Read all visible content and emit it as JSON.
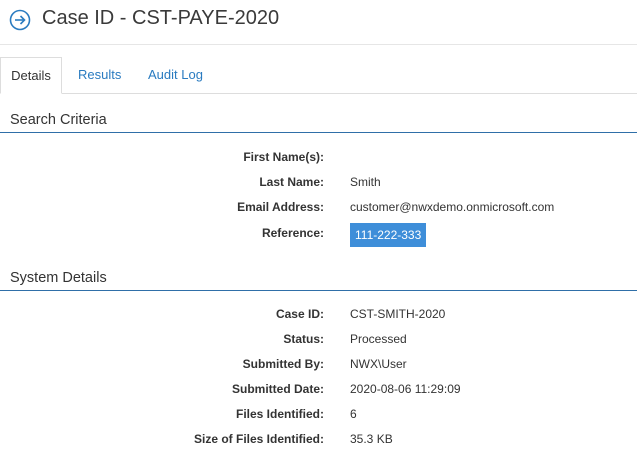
{
  "header": {
    "title": "Case ID - CST-PAYE-2020",
    "icon": "arrow-right-circle-icon",
    "accent_color": "#2a7bc0"
  },
  "tabs": [
    {
      "label": "Details",
      "active": true
    },
    {
      "label": "Results",
      "active": false
    },
    {
      "label": "Audit Log",
      "active": false
    }
  ],
  "search_criteria": {
    "title": "Search Criteria",
    "fields": [
      {
        "label": "First Name(s):",
        "value": ""
      },
      {
        "label": "Last Name:",
        "value": "Smith"
      },
      {
        "label": "Email Address:",
        "value": "customer@nwxdemo.onmicrosoft.com"
      },
      {
        "label": "Reference:",
        "value": "111-222-333"
      }
    ]
  },
  "system_details": {
    "title": "System Details",
    "fields": [
      {
        "label": "Case ID:",
        "value": "CST-SMITH-2020"
      },
      {
        "label": "Status:",
        "value": "Processed"
      },
      {
        "label": "Submitted By:",
        "value": "NWX\\User"
      },
      {
        "label": "Submitted Date:",
        "value": "2020-08-06 11:29:09"
      },
      {
        "label": "Files Identified:",
        "value": "6"
      },
      {
        "label": "Size of Files Identified:",
        "value": "35.3 KB"
      }
    ]
  },
  "highlight_color": "#3e8ed9"
}
